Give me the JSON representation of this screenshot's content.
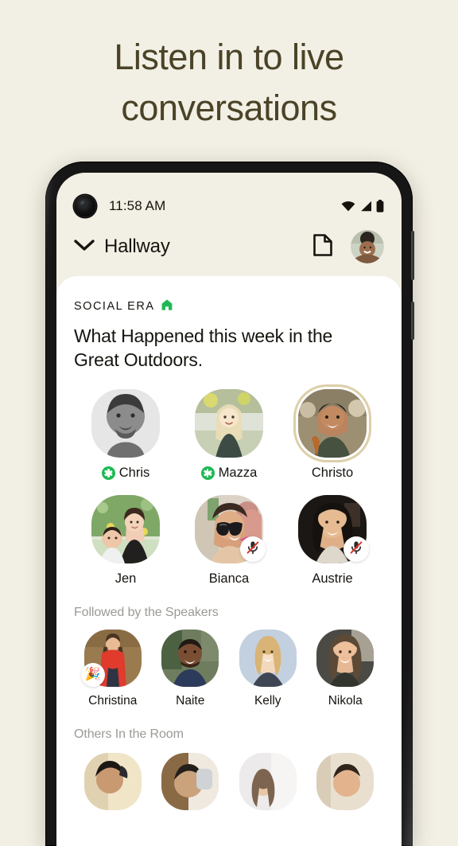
{
  "promo": {
    "headline": "Listen in to live\nconversations",
    "headline_color": "#4A4327",
    "background_color": "#F2EFE4"
  },
  "status_bar": {
    "time": "11:58 AM",
    "icons": [
      "wifi-icon",
      "cellular-signal-icon",
      "battery-icon"
    ]
  },
  "app_bar": {
    "chevron_icon": "chevron-down-icon",
    "room_name": "Hallway",
    "document_icon": "document-icon",
    "profile_avatar": "user-avatar"
  },
  "room": {
    "kicker": "SOCIAL ERA",
    "kicker_icon": "house-icon",
    "kicker_icon_color": "#1DB954",
    "title": "What Happened this week in the\nGreat Outdoors.",
    "speakers": [
      {
        "name": "Chris",
        "moderator": true,
        "muted": false,
        "speaking": false
      },
      {
        "name": "Mazza",
        "moderator": true,
        "muted": false,
        "speaking": false
      },
      {
        "name": "Christo",
        "moderator": false,
        "muted": false,
        "speaking": true
      },
      {
        "name": "Jen",
        "moderator": false,
        "muted": false,
        "speaking": false
      },
      {
        "name": "Bianca",
        "moderator": false,
        "muted": true,
        "speaking": false
      },
      {
        "name": "Austrie",
        "moderator": false,
        "muted": true,
        "speaking": false
      }
    ],
    "followed_label": "Followed by the Speakers",
    "followers": [
      {
        "name": "Christina",
        "new_badge": "🎉"
      },
      {
        "name": "Naite",
        "new_badge": ""
      },
      {
        "name": "Kelly",
        "new_badge": ""
      },
      {
        "name": "Nikola",
        "new_badge": ""
      }
    ],
    "others_label": "Others In the Room",
    "others_count": 4
  },
  "theme": {
    "card_background": "#FFFFFF",
    "speaking_ring": "#DCCFA8",
    "muted_slash": "#E0342B",
    "muted_text": "#9A9A96"
  }
}
